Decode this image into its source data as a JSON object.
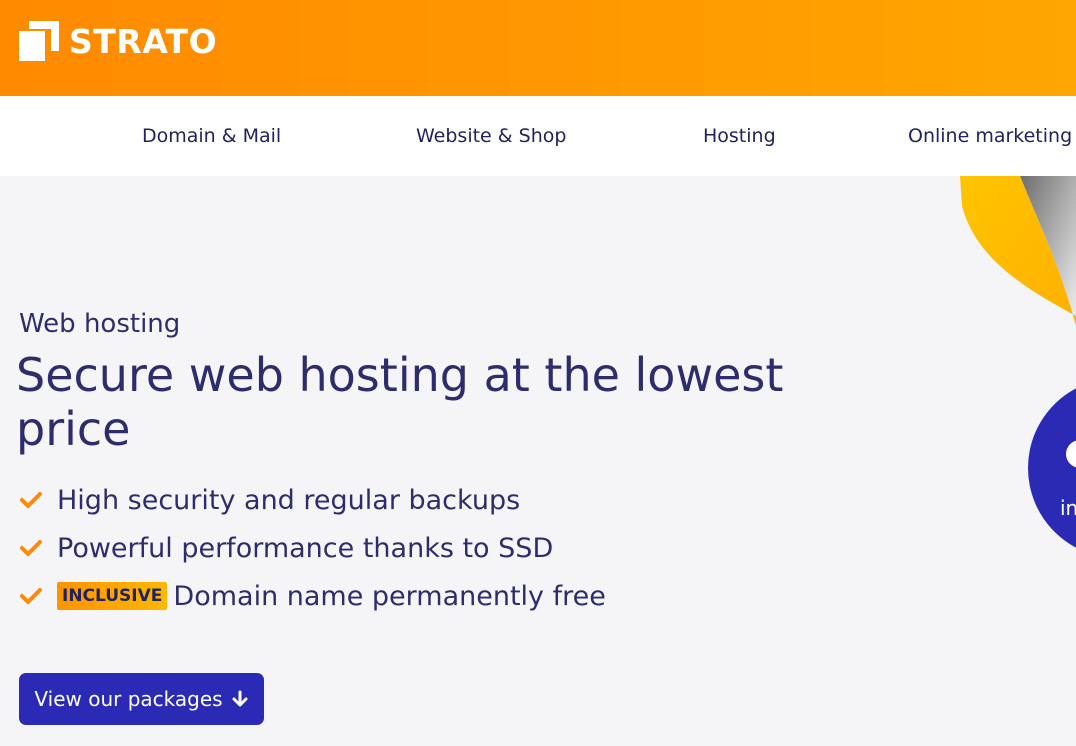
{
  "brand": {
    "name": "STRATO",
    "logo_icon": "strato-logo-icon",
    "color_primary": "#ff8a00",
    "color_accent": "#2a2ab4",
    "color_text": "#2d2d6e"
  },
  "nav": {
    "items": [
      {
        "label": "Domain & Mail"
      },
      {
        "label": "Website & Shop"
      },
      {
        "label": "Hosting"
      },
      {
        "label": "Online marketing"
      }
    ]
  },
  "hero": {
    "eyebrow": "Web hosting",
    "headline": "Secure web hosting at the lowest price",
    "features": [
      {
        "text": "High security and regular backups",
        "icon": "checkmark-icon"
      },
      {
        "text": "Powerful performance thanks to SSD",
        "icon": "checkmark-icon"
      },
      {
        "badge": "INCLUSIVE",
        "text": "Domain name permanently free",
        "icon": "checkmark-icon"
      }
    ],
    "cta": {
      "label": "View our packages",
      "icon": "arrow-down-icon"
    },
    "promo": {
      "text": "in"
    }
  }
}
